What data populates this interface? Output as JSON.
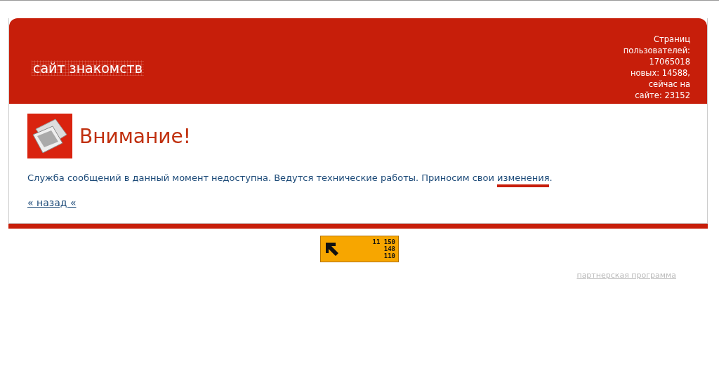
{
  "header": {
    "logo": "сайт знакомств",
    "stats": [
      "Страниц",
      "пользователей:",
      "17065018",
      "новых: 14588,",
      "сейчас на",
      "сайте: 23152"
    ]
  },
  "notice": {
    "title": "Внимание!",
    "message": {
      "before": "Служба сообщений в данный момент недоступна. Ведутся технические работы. Приносим свои ",
      "highlight": "изменения",
      "after": "."
    },
    "back_link": "« назад «"
  },
  "counter": {
    "lines": [
      "11 150",
      "148",
      "110"
    ]
  },
  "footer": {
    "partner_link": "партнерская программа"
  }
}
